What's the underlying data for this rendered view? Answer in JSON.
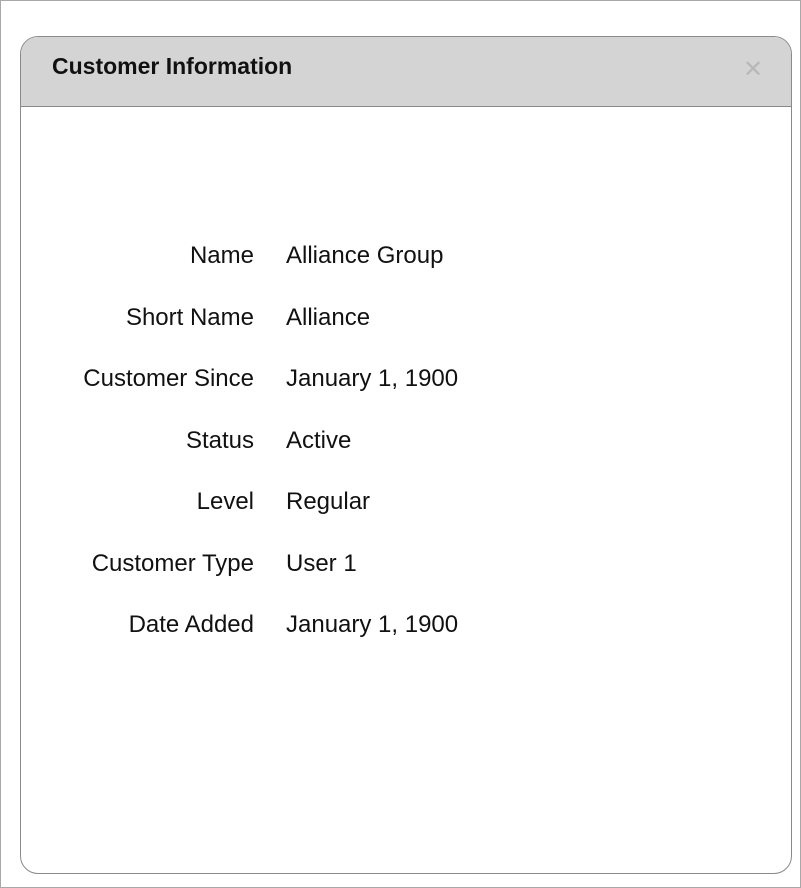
{
  "dialog": {
    "title": "Customer Information",
    "close_icon": "close-icon",
    "close_glyph": "✕"
  },
  "fields": [
    {
      "label": "Name",
      "value": "Alliance Group"
    },
    {
      "label": "Short Name",
      "value": "Alliance"
    },
    {
      "label": "Customer Since",
      "value": "January 1, 1900"
    },
    {
      "label": "Status",
      "value": "Active"
    },
    {
      "label": "Level",
      "value": "Regular"
    },
    {
      "label": "Customer Type",
      "value": "User 1"
    },
    {
      "label": "Date Added",
      "value": "January 1, 1900"
    }
  ],
  "colors": {
    "header_background": "#d4d4d4",
    "border": "#8a8a8a",
    "close_icon": "#b8b8b8"
  }
}
